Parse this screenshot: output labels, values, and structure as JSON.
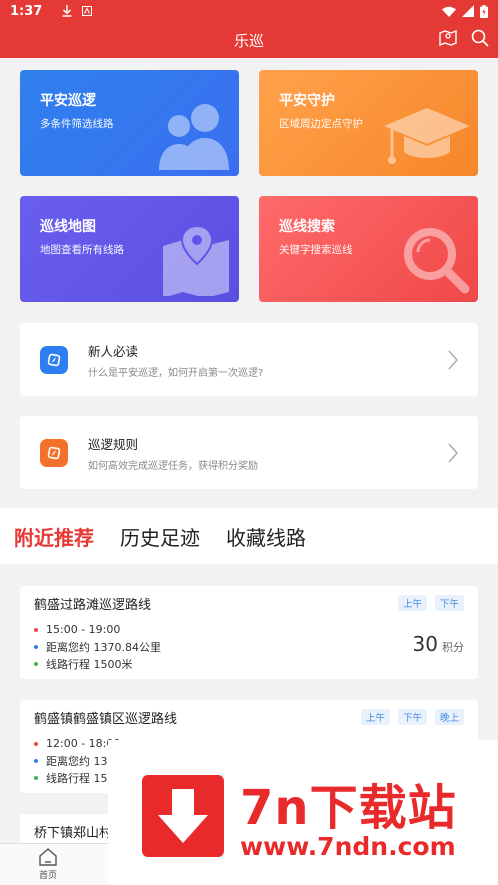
{
  "status_bar": {
    "time": "1:37",
    "icons": [
      "download-icon",
      "app-icon",
      "wifi-icon",
      "signal-icon",
      "battery-icon"
    ]
  },
  "header": {
    "title": "乐巡",
    "icons": [
      "map-icon",
      "search-icon"
    ]
  },
  "feature_cards": [
    {
      "title": "平安巡逻",
      "subtitle": "多条件筛选线路",
      "icon": "users-icon",
      "color": "#3578ee"
    },
    {
      "title": "平安守护",
      "subtitle": "区域周边定点守护",
      "icon": "graduation-cap-icon",
      "color": "#f99136"
    },
    {
      "title": "巡线地图",
      "subtitle": "地图查看所有线路",
      "icon": "map-pin-icon",
      "color": "#6357ea"
    },
    {
      "title": "巡线搜索",
      "subtitle": "关键字搜索巡线",
      "icon": "magnifier-icon",
      "color": "#f55959"
    }
  ],
  "guides": [
    {
      "title": "新人必读",
      "subtitle": "什么是平安巡逻，如何开启第一次巡逻?",
      "icon": "compass-icon",
      "color": "#2f7ef0"
    },
    {
      "title": "巡逻规则",
      "subtitle": "如何高效完成巡逻任务，获得积分奖励",
      "icon": "compass-icon",
      "color": "#f5702a"
    }
  ],
  "tabs": [
    {
      "label": "附近推荐",
      "active": true
    },
    {
      "label": "历史足迹",
      "active": false
    },
    {
      "label": "收藏线路",
      "active": false
    }
  ],
  "routes": [
    {
      "title": "鹤盛过路滩巡逻路线",
      "tags": [
        "上午",
        "下午"
      ],
      "time": "15:00 - 19:00",
      "distance": "距离您约 1370.84公里",
      "length": "线路行程 1500米",
      "points": "30",
      "points_unit": "积分"
    },
    {
      "title": "鹤盛镇鹤盛镇区巡逻路线",
      "tags": [
        "上午",
        "下午",
        "晚上"
      ],
      "time": "12:00 - 18:00",
      "distance": "距离您约 13",
      "length": "线路行程 15"
    },
    {
      "title": "桥下镇郑山村"
    }
  ],
  "bottom_nav": {
    "home_label": "首页"
  },
  "watermark": {
    "text": "7n下载站",
    "url": "www.7ndn.com"
  },
  "colors": {
    "primary": "#e53935",
    "tag_text": "#4a8fe0",
    "dot_red": "#f04848",
    "dot_blue": "#2f80ed",
    "dot_green": "#3cba54"
  }
}
